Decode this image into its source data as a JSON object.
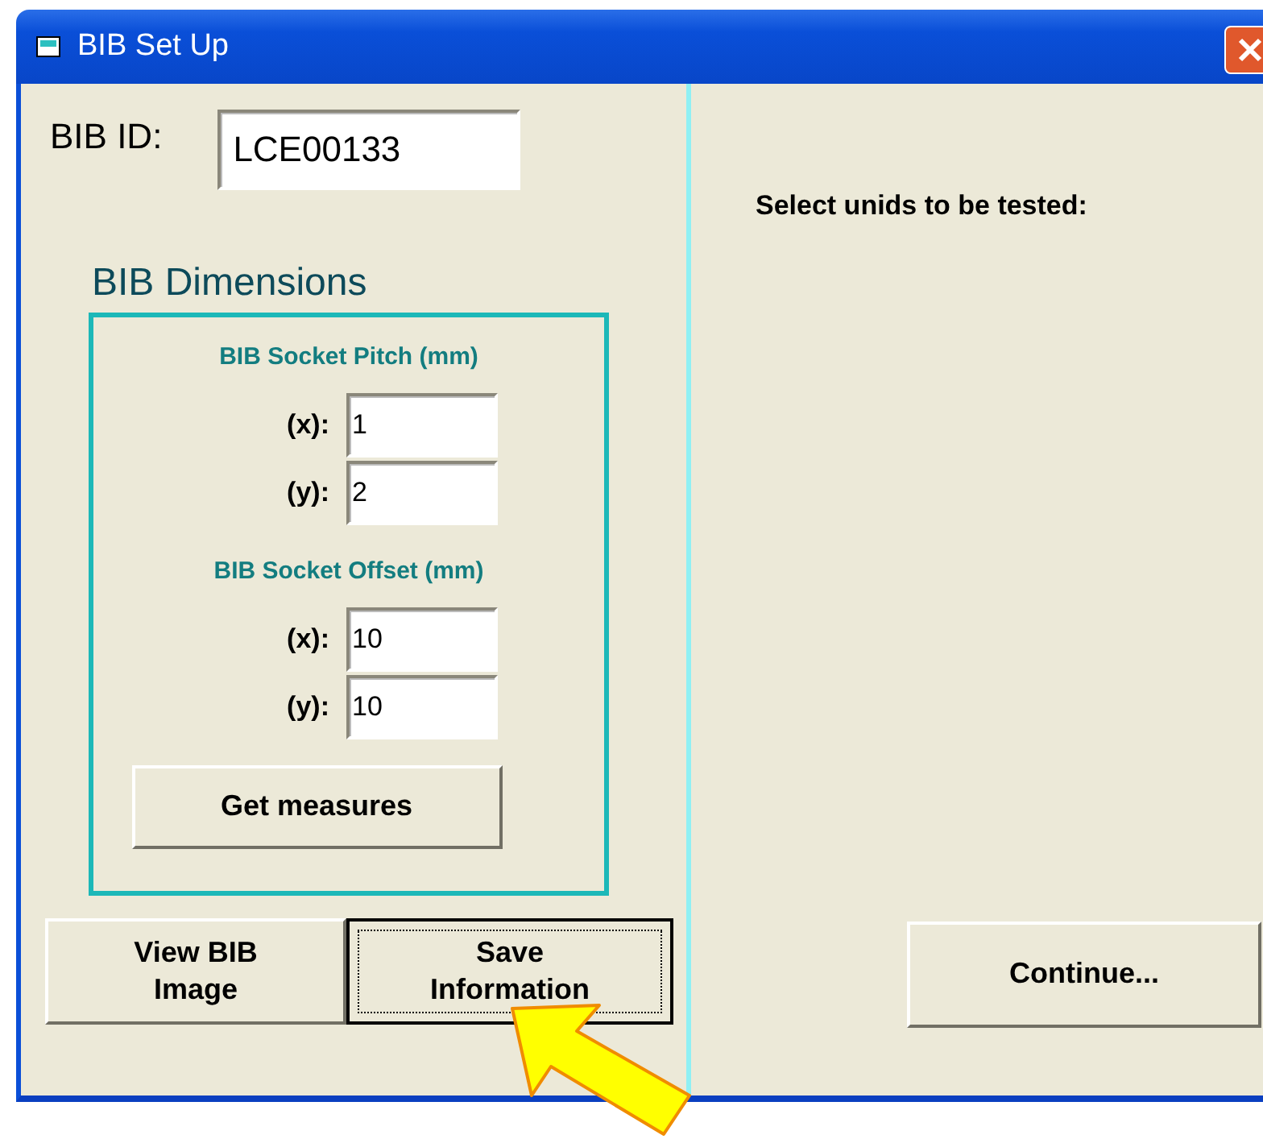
{
  "window": {
    "title": "BIB Set Up"
  },
  "bib_id": {
    "label": "BIB ID:",
    "value": "LCE00133"
  },
  "dimensions": {
    "title": "BIB Dimensions",
    "groups": [
      {
        "heading": "BIB Socket Pitch (mm)",
        "fields": [
          {
            "label": "(x):",
            "value": "1"
          },
          {
            "label": "(y):",
            "value": "2"
          }
        ]
      },
      {
        "heading": "BIB Socket Offset (mm)",
        "fields": [
          {
            "label": "(x):",
            "value": "10"
          },
          {
            "label": "(y):",
            "value": "10"
          }
        ]
      }
    ],
    "button": "Get measures"
  },
  "buttons": [
    {
      "label": "View BIB\nImage",
      "focused": false
    },
    {
      "label": "Save\nInformation",
      "focused": true
    }
  ],
  "right_panel": {
    "prompt": "Select unids to be tested:",
    "button": "Continue..."
  }
}
